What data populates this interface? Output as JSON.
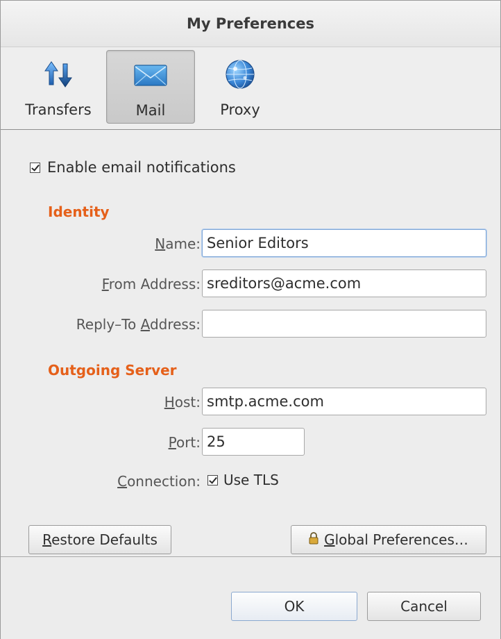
{
  "window": {
    "title": "My Preferences"
  },
  "toolbar": {
    "items": [
      {
        "label": "Transfers",
        "icon": "transfers-icon",
        "active": false
      },
      {
        "label": "Mail",
        "icon": "mail-icon",
        "active": true
      },
      {
        "label": "Proxy",
        "icon": "globe-icon",
        "active": false
      }
    ]
  },
  "notifications": {
    "label": "Enable email notifications",
    "checked": true
  },
  "identity": {
    "heading": "Identity",
    "name_label": "Name:",
    "name_value": "Senior Editors",
    "from_label": "From Address:",
    "from_value": "sreditors@acme.com",
    "reply_label": "Reply–To Address:",
    "reply_value": ""
  },
  "server": {
    "heading": "Outgoing Server",
    "host_label": "Host:",
    "host_value": "smtp.acme.com",
    "port_label": "Port:",
    "port_value": "25",
    "connection_label": "Connection:",
    "tls_label": "Use TLS",
    "tls_checked": true
  },
  "buttons": {
    "restore": "Restore Defaults",
    "global": "Global Preferences…",
    "ok": "OK",
    "cancel": "Cancel"
  },
  "colors": {
    "section_heading": "#e5601a",
    "focus_border": "#7fa7d6"
  }
}
